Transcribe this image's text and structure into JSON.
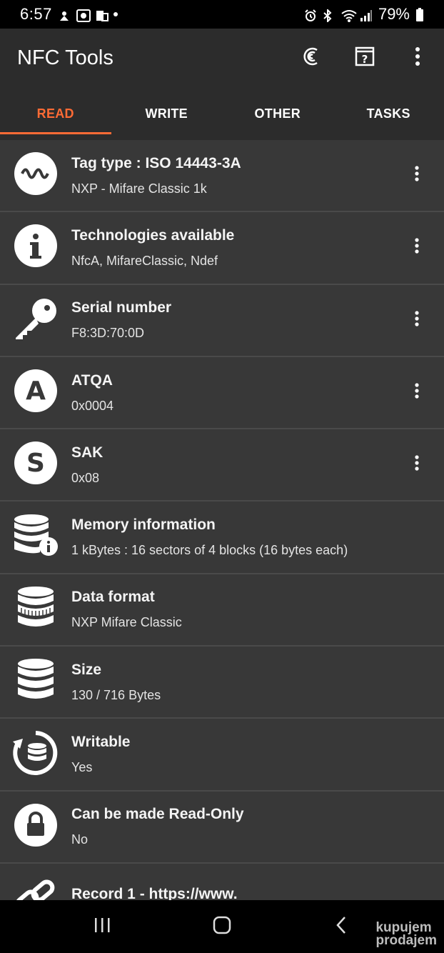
{
  "status_bar": {
    "time": "6:57",
    "battery": "79%",
    "icons_left": [
      "notification-app-icon",
      "notification-app-icon",
      "notification-app-icon"
    ],
    "icons_right": [
      "alarm-icon",
      "bluetooth-icon",
      "wifi-icon",
      "signal-icon",
      "battery-icon"
    ]
  },
  "app_bar": {
    "title": "NFC Tools",
    "actions": [
      "nfc-scan-icon",
      "help-icon",
      "overflow-menu-icon"
    ]
  },
  "tabs": [
    {
      "label": "READ",
      "active": true
    },
    {
      "label": "WRITE",
      "active": false
    },
    {
      "label": "OTHER",
      "active": false
    },
    {
      "label": "TASKS",
      "active": false
    }
  ],
  "rows": [
    {
      "title": "Tag type : ISO 14443-3A",
      "value": "NXP - Mifare Classic 1k",
      "icon": "wave-icon",
      "menu": true
    },
    {
      "title": "Technologies available",
      "value": "NfcA, MifareClassic, Ndef",
      "icon": "info-icon",
      "menu": true
    },
    {
      "title": "Serial number",
      "value": "F8:3D:70:0D",
      "icon": "key-icon",
      "menu": true
    },
    {
      "title": "ATQA",
      "value": "0x0004",
      "icon": "letter-a-icon",
      "menu": true
    },
    {
      "title": "SAK",
      "value": "0x08",
      "icon": "letter-s-icon",
      "menu": true
    },
    {
      "title": "Memory information",
      "value": "1 kBytes : 16 sectors of 4 blocks (16 bytes each)",
      "icon": "database-info-icon",
      "menu": false
    },
    {
      "title": "Data format",
      "value": "NXP Mifare Classic",
      "icon": "database-format-icon",
      "menu": false
    },
    {
      "title": "Size",
      "value": "130 / 716 Bytes",
      "icon": "database-icon",
      "menu": false
    },
    {
      "title": "Writable",
      "value": "Yes",
      "icon": "database-refresh-icon",
      "menu": false
    },
    {
      "title": "Can be made Read-Only",
      "value": "No",
      "icon": "lock-icon",
      "menu": false
    },
    {
      "title": "Record 1 - https://www.",
      "value": "",
      "icon": "link-icon",
      "menu": false
    }
  ],
  "nav_bar": [
    "recents-icon",
    "home-icon",
    "back-icon"
  ],
  "watermark": {
    "line1": "kupujem",
    "line2": "prodajem"
  },
  "colors": {
    "accent": "#ff6b35",
    "app_bar": "#2c2c2c",
    "list_bg": "#383838",
    "divider": "#4a4a4a"
  }
}
